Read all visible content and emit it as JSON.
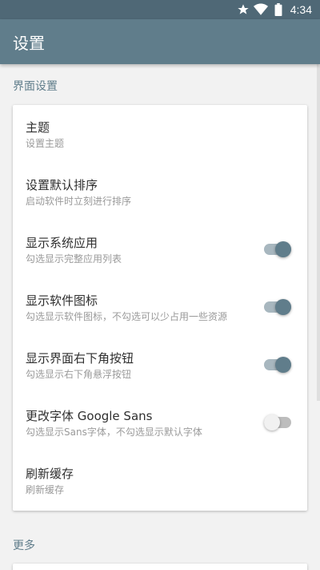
{
  "status_bar": {
    "time": "4:34",
    "icons": [
      "star-icon",
      "wifi-icon",
      "battery-icon"
    ]
  },
  "app_bar": {
    "title": "设置"
  },
  "sections": {
    "interface": {
      "title": "界面设置",
      "items": [
        {
          "title": "主题",
          "subtitle": "设置主题"
        },
        {
          "title": "设置默认排序",
          "subtitle": "启动软件时立刻进行排序"
        },
        {
          "title": "显示系统应用",
          "subtitle": "勾选显示完整应用列表",
          "toggle": true
        },
        {
          "title": "显示软件图标",
          "subtitle": "勾选显示软件图标，不勾选可以少占用一些资源",
          "toggle": true
        },
        {
          "title": "显示界面右下角按钮",
          "subtitle": "勾选显示右下角悬浮按钮",
          "toggle": true
        },
        {
          "title": "更改字体 Google Sans",
          "subtitle": "勾选显示Sans字体，不勾选显示默认字体",
          "toggle": false
        },
        {
          "title": "刷新缓存",
          "subtitle": "刷新缓存"
        }
      ]
    },
    "more": {
      "title": "更多"
    }
  },
  "colors": {
    "primary": "#607d8b",
    "primary_dark": "#4f6876",
    "background": "#f2f2f2"
  }
}
